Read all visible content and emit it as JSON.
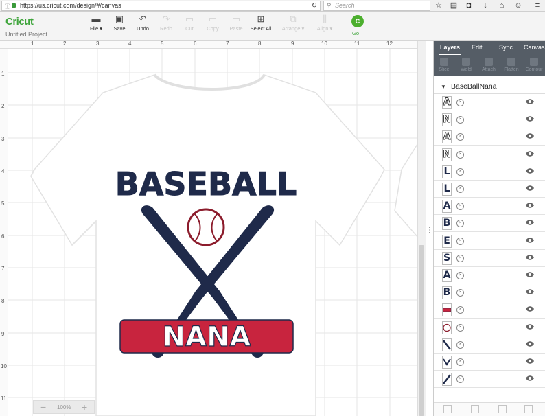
{
  "browser": {
    "url": "https://us.cricut.com/design/#/canvas",
    "search_placeholder": "Search"
  },
  "app": {
    "logo": "Cricut",
    "project_name": "Untitled Project",
    "toolbar": [
      {
        "label": "File ▾",
        "icon": "folder-icon",
        "enabled": true
      },
      {
        "label": "Save",
        "icon": "save-icon",
        "enabled": true
      },
      {
        "label": "Undo",
        "icon": "undo-icon",
        "enabled": true
      },
      {
        "label": "Redo",
        "icon": "redo-icon",
        "enabled": false
      },
      {
        "label": "Cut",
        "icon": "cut-icon",
        "enabled": false
      },
      {
        "label": "Copy",
        "icon": "copy-icon",
        "enabled": false
      },
      {
        "label": "Paste",
        "icon": "paste-icon",
        "enabled": false
      },
      {
        "label": "Select All",
        "icon": "select-all-icon",
        "enabled": true
      },
      {
        "label": "Arrange ▾",
        "icon": "arrange-icon",
        "enabled": false
      },
      {
        "label": "Align ▾",
        "icon": "align-icon",
        "enabled": false
      }
    ],
    "go_badge": "C",
    "go_label": "Go"
  },
  "canvas": {
    "ruler_top": [
      "1",
      "2",
      "3",
      "4",
      "5",
      "6",
      "7",
      "8",
      "9",
      "10",
      "11",
      "12"
    ],
    "ruler_left": [
      "1",
      "2",
      "3",
      "4",
      "5",
      "6",
      "7",
      "8",
      "9",
      "10",
      "11"
    ],
    "zoom": "100%",
    "design": {
      "title_text": "BASEBALL",
      "banner_text": "NANA",
      "colors": {
        "navy": "#1f2a4a",
        "red": "#c8243e",
        "white": "#ffffff"
      }
    }
  },
  "panel": {
    "tabs": [
      "Layers",
      "Edit",
      "Sync",
      "Canvas"
    ],
    "active_tab": "Layers",
    "actions": [
      "Slice",
      "Weld",
      "Attach",
      "Flatten",
      "Contour"
    ],
    "group_name": "BaseBallNana",
    "layers": [
      {
        "glyph": "A",
        "style": "outline"
      },
      {
        "glyph": "N",
        "style": "outline"
      },
      {
        "glyph": "A",
        "style": "outline"
      },
      {
        "glyph": "N",
        "style": "outline"
      },
      {
        "glyph": "L",
        "style": "solid"
      },
      {
        "glyph": "L",
        "style": "solid"
      },
      {
        "glyph": "A",
        "style": "solid"
      },
      {
        "glyph": "B",
        "style": "solid"
      },
      {
        "glyph": "E",
        "style": "solid"
      },
      {
        "glyph": "S",
        "style": "solid"
      },
      {
        "glyph": "A",
        "style": "solid"
      },
      {
        "glyph": "B",
        "style": "solid"
      },
      {
        "glyph": "",
        "style": "banner"
      },
      {
        "glyph": "",
        "style": "ball"
      },
      {
        "glyph": "",
        "style": "bat-left"
      },
      {
        "glyph": "",
        "style": "bats-v"
      },
      {
        "glyph": "",
        "style": "bat-right"
      }
    ]
  }
}
